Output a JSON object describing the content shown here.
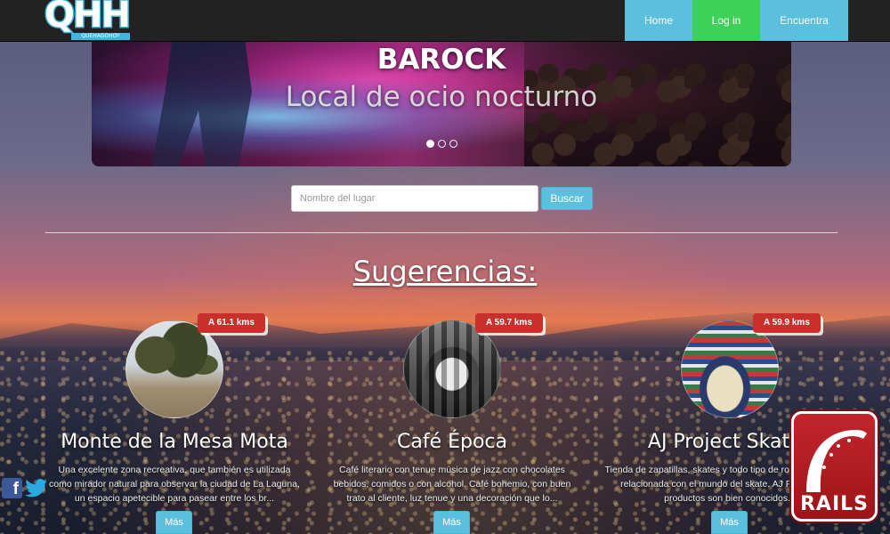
{
  "navbar": {
    "logo_text": "QHH",
    "logo_sub": "QUEHAGOHOY",
    "links": [
      {
        "label": "Home"
      },
      {
        "label": "Log in"
      },
      {
        "label": "Encuentra"
      }
    ],
    "colors": {
      "home": "#5bc0de",
      "login": "#3ed15a",
      "encuentra": "#5bc0de"
    }
  },
  "carousel": {
    "title": "BAROCK",
    "subtitle": "Local de ocio nocturno",
    "slide_count": 3,
    "active_slide": 1
  },
  "search": {
    "placeholder": "Nombre del lugar",
    "value": "",
    "button_label": "Buscar"
  },
  "section_title": "Sugerencias:",
  "suggestions": [
    {
      "distance": "A 61.1 kms",
      "title": "Monte de la Mesa Mota",
      "description": "Una excelente zona recreativa, que también es utilizada como mirador natural para observar la ciudad de La Laguna, un espacio apetecible para pasear entre los br...",
      "button_label": "Más",
      "thumb_icon": "trees-photo"
    },
    {
      "distance": "A 59.7 kms",
      "title": "Café Época",
      "description": "Café literario con tenue música de jazz con chocolates bebidos, comidos o con alcohol. Café bohemio, con buen trato al cliente, luz tenue y una decoración que lo...",
      "button_label": "Más",
      "thumb_icon": "espresso-machine-photo"
    },
    {
      "distance": "A 59.9 kms",
      "title": "AJ Project Skates",
      "description": "Tienda de zapatillas, skates y todo tipo de ropa y vestimenta relacionada con el mundo del skate. AJ Project y sus productos son bien conocidos...",
      "button_label": "Más",
      "thumb_icon": "skate-shop-photo"
    }
  ],
  "social": {
    "facebook_icon": "facebook-icon",
    "twitter_icon": "twitter-icon"
  },
  "rails_badge": {
    "label": "RAILS"
  }
}
